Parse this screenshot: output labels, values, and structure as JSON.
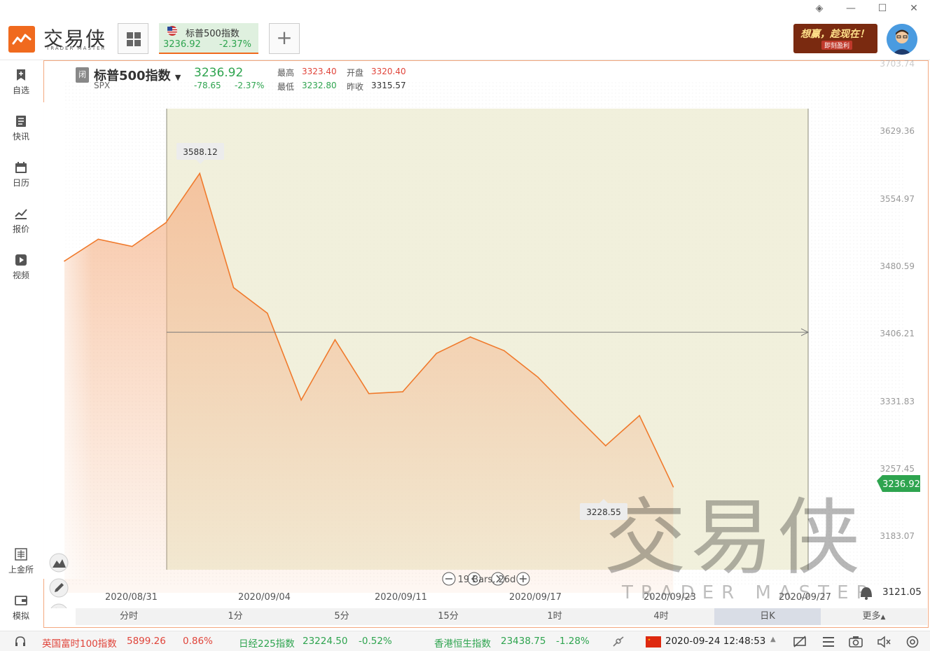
{
  "header": {
    "logo_text": "交易侠",
    "logo_sub": "TRADER MASTER",
    "tab": {
      "title": "标普500指数",
      "price": "3236.92",
      "pct": "-2.37%"
    },
    "add_label": "+",
    "ad_text_1": "想赢，趁现在！",
    "ad_text_2": "即刻盈利"
  },
  "sidebar": {
    "items": [
      {
        "label": "自选",
        "icon": "bookmark-plus-icon"
      },
      {
        "label": "快讯",
        "icon": "news-list-icon"
      },
      {
        "label": "日历",
        "icon": "calendar-icon"
      },
      {
        "label": "报价",
        "icon": "trend-line-icon"
      },
      {
        "label": "视频",
        "icon": "play-icon"
      }
    ],
    "bottom_items": [
      {
        "label": "上金所",
        "icon": "sge-icon"
      },
      {
        "label": "模拟",
        "icon": "wallet-icon"
      }
    ]
  },
  "symbol": {
    "status": "闭",
    "name": "标普500指数",
    "code": "SPX",
    "price": "3236.92",
    "change": "-78.65",
    "change_pct": "-2.37%",
    "high_label": "最高",
    "high": "3323.40",
    "open_label": "开盘",
    "open": "3320.40",
    "low_label": "最低",
    "low": "3232.80",
    "prev_label": "昨收",
    "prev": "3315.57"
  },
  "chart_data": {
    "type": "area",
    "x": [
      "2020/08/27",
      "2020/08/28",
      "2020/08/31",
      "2020/09/01",
      "2020/09/02",
      "2020/09/03",
      "2020/09/04",
      "2020/09/08",
      "2020/09/09",
      "2020/09/10",
      "2020/09/11",
      "2020/09/14",
      "2020/09/15",
      "2020/09/16",
      "2020/09/17",
      "2020/09/18",
      "2020/09/21",
      "2020/09/22",
      "2020/09/23"
    ],
    "y": [
      3484,
      3508,
      3500,
      3526,
      3580,
      3455,
      3427,
      3332,
      3398,
      3339,
      3341,
      3383,
      3401,
      3386,
      3357,
      3319,
      3282,
      3315,
      3237
    ],
    "y_ticks": [
      "3703.74",
      "3629.36",
      "3554.97",
      "3480.59",
      "3406.21",
      "3331.83",
      "3257.45",
      "3183.07",
      "3121.05"
    ],
    "x_ticks": [
      "2020/08/31",
      "2020/09/04",
      "2020/09/11",
      "2020/09/17",
      "2020/09/23",
      "2020/09/27"
    ],
    "ylim": [
      3121.05,
      3703.74
    ],
    "max_label": "3588.12",
    "min_label": "3228.55",
    "last_label": "3236.92",
    "crosshair_y": 3406.21,
    "bars_text": "19 Bars, 26d",
    "colors": {
      "line": "#f07a2c",
      "fill": "#f5b48a",
      "highlight": "#ecebd0",
      "last": "#2ea44f"
    }
  },
  "timeframes": [
    "分时",
    "1分",
    "5分",
    "15分",
    "1时",
    "4时",
    "日K",
    "更多"
  ],
  "active_timeframe": "日K",
  "ticker": [
    {
      "name": "英国富时100指数",
      "price": "5899.26",
      "pct": "0.86%",
      "dir": "up"
    },
    {
      "name": "日经225指数",
      "price": "23224.50",
      "pct": "-0.52%",
      "dir": "down"
    },
    {
      "name": "香港恒生指数",
      "price": "23438.75",
      "pct": "-1.28%",
      "dir": "down"
    }
  ],
  "datetime": "2020-09-24 12:48:53",
  "watermark": {
    "text": "交易侠",
    "sub": "TRADER MASTER"
  }
}
